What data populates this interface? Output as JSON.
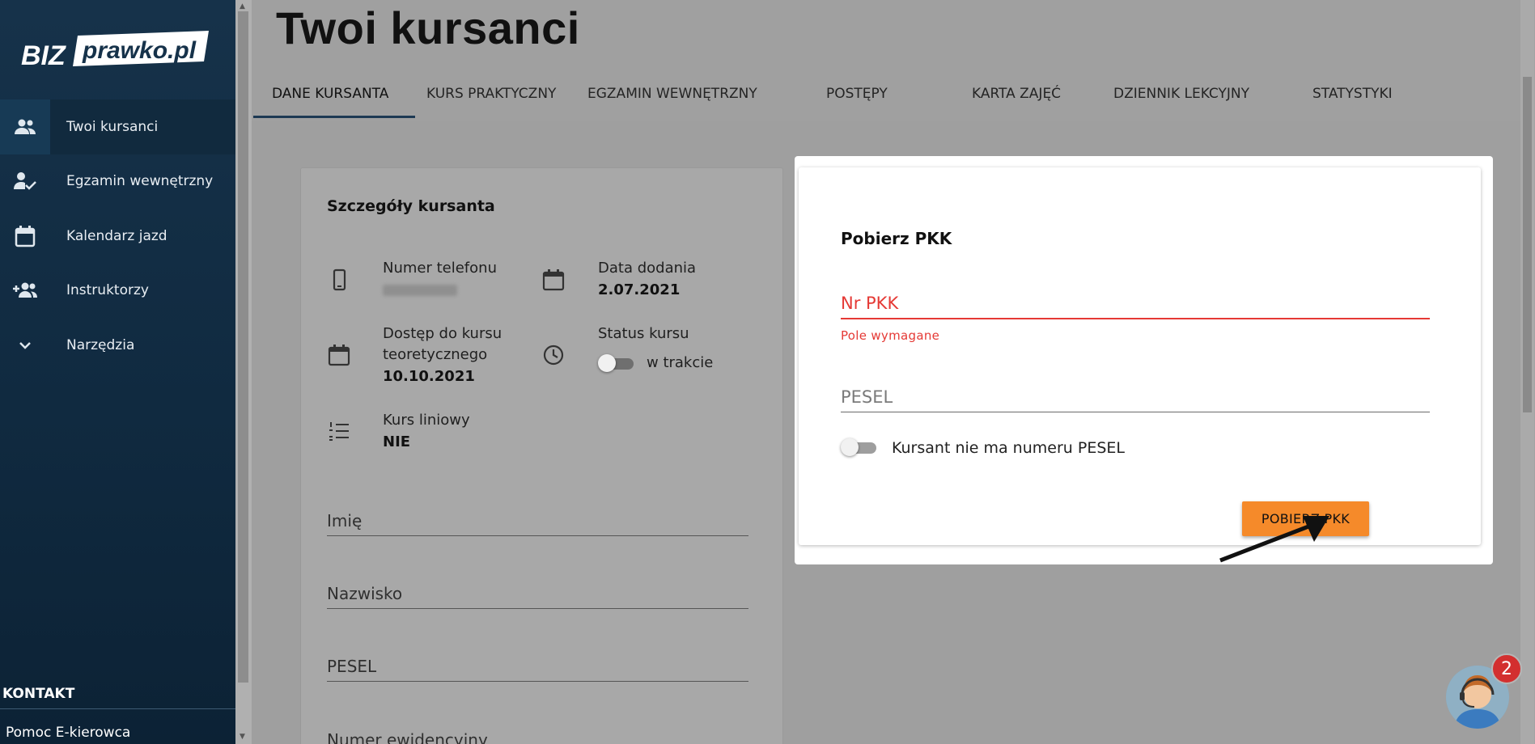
{
  "brand": {
    "logo_text_left": "BIZ",
    "logo_text_right": "prawko.pl"
  },
  "sidebar": {
    "items": [
      {
        "label": "Twoi kursanci",
        "icon": "people-icon"
      },
      {
        "label": "Egzamin wewnętrzny",
        "icon": "person-check-icon"
      },
      {
        "label": "Kalendarz jazd",
        "icon": "calendar-icon"
      },
      {
        "label": "Instruktorzy",
        "icon": "add-group-icon"
      },
      {
        "label": "Narzędzia",
        "icon": "chevron-down-icon"
      }
    ],
    "kontakt": "KONTAKT",
    "pomoc": "Pomoc E-kierowca"
  },
  "page": {
    "title": "Twoi kursanci"
  },
  "tabs": [
    "DANE KURSANTA",
    "KURS PRAKTYCZNY",
    "EGZAMIN WEWNĘTRZNY",
    "POSTĘPY",
    "KARTA ZAJĘĆ",
    "DZIENNIK LEKCYJNY",
    "STATYSTYKI"
  ],
  "details": {
    "title": "Szczegóły kursanta",
    "phone_label": "Numer telefonu",
    "date_label": "Data dodania",
    "date_value": "2.07.2021",
    "access_label_1": "Dostęp do kursu",
    "access_label_2": "teoretycznego",
    "access_value": "10.10.2021",
    "status_label": "Status kursu",
    "status_value": "w trakcie",
    "linear_label": "Kurs liniowy",
    "linear_value": "NIE",
    "fields": {
      "first_name": "Imię",
      "last_name": "Nazwisko",
      "pesel": "PESEL",
      "record_no": "Numer ewidencyjny"
    }
  },
  "modal": {
    "title": "Pobierz PKK",
    "nr_pkk_label": "Nr PKK",
    "nr_pkk_error": "Pole wymagane",
    "pesel_label": "PESEL",
    "no_pesel_label": "Kursant nie ma numeru PESEL",
    "submit": "POBIERZ PKK"
  },
  "chat": {
    "badge": "2"
  },
  "colors": {
    "accent": "#f58a2a",
    "error": "#e53935",
    "sidebar": "#16324a",
    "tab_indicator": "#1d3953"
  }
}
